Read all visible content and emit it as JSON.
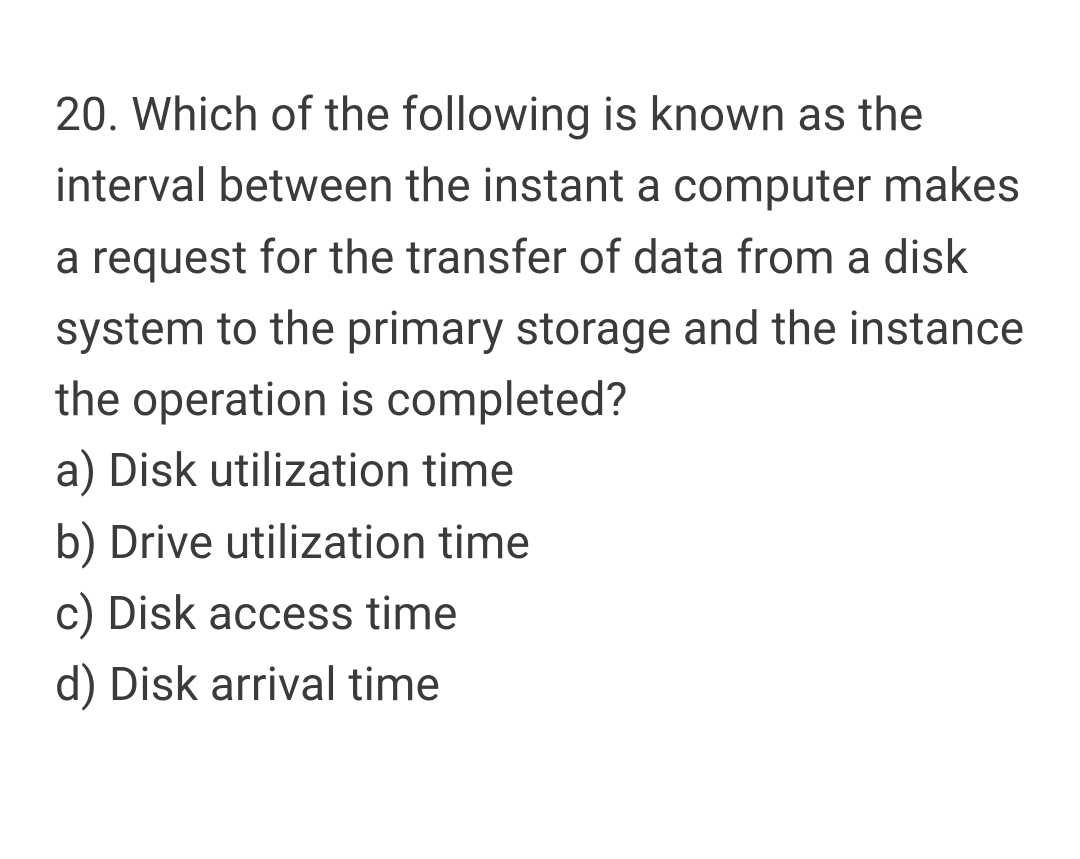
{
  "question": {
    "number": "20.",
    "text": "Which of the following is known as the interval between the instant a computer makes a request for the transfer of data from a disk system to the primary storage and the instance the operation is completed?",
    "options": [
      {
        "label": "a)",
        "text": "Disk utilization time"
      },
      {
        "label": "b)",
        "text": "Drive utilization time"
      },
      {
        "label": "c)",
        "text": "Disk access time"
      },
      {
        "label": "d)",
        "text": "Disk arrival time"
      }
    ]
  }
}
